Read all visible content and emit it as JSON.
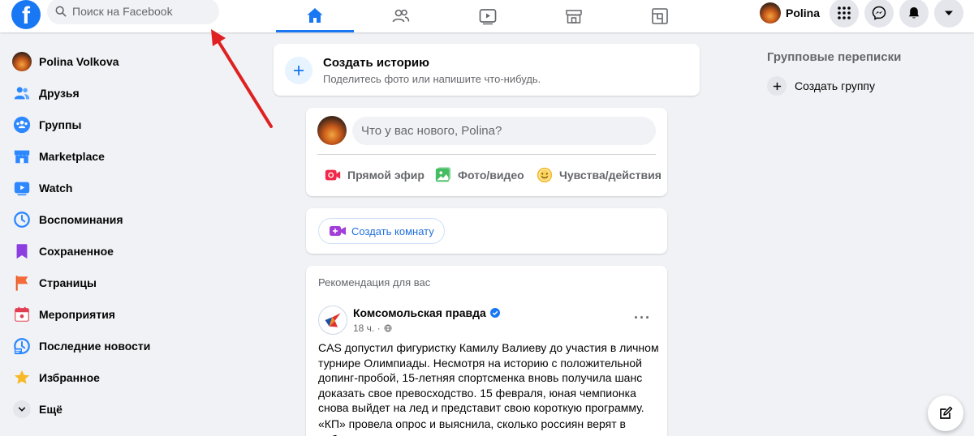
{
  "header": {
    "logo_letter": "f",
    "search_placeholder": "Поиск на Facebook",
    "profile_name": "Polina",
    "nav_tabs": [
      "home-icon",
      "friends-icon",
      "watch-icon",
      "marketplace-icon",
      "gaming-icon"
    ],
    "active_tab": "home-icon",
    "right_buttons": [
      "menu-grid-icon",
      "messenger-icon",
      "notifications-icon",
      "account-dropdown-icon"
    ]
  },
  "sidebar": {
    "items": [
      {
        "label": "Polina Volkova",
        "icon": "user-avatar"
      },
      {
        "label": "Друзья",
        "icon": "friends-icon"
      },
      {
        "label": "Группы",
        "icon": "groups-icon"
      },
      {
        "label": "Marketplace",
        "icon": "marketplace-icon"
      },
      {
        "label": "Watch",
        "icon": "watch-icon"
      },
      {
        "label": "Воспоминания",
        "icon": "memories-icon"
      },
      {
        "label": "Сохраненное",
        "icon": "saved-icon"
      },
      {
        "label": "Страницы",
        "icon": "pages-icon"
      },
      {
        "label": "Мероприятия",
        "icon": "events-icon"
      },
      {
        "label": "Последние новости",
        "icon": "recent-news-icon"
      },
      {
        "label": "Избранное",
        "icon": "favorites-icon"
      },
      {
        "label": "Ещё",
        "icon": "chevron-down-icon"
      }
    ]
  },
  "story": {
    "title": "Создать историю",
    "subtitle": "Поделитесь фото или напишите что-нибудь."
  },
  "composer": {
    "placeholder": "Что у вас нового, Polina?",
    "actions": [
      {
        "label": "Прямой эфир",
        "icon": "live-video-icon",
        "color": "#f02849"
      },
      {
        "label": "Фото/видео",
        "icon": "photo-video-icon",
        "color": "#45bd62"
      },
      {
        "label": "Чувства/действия",
        "icon": "feeling-icon",
        "color": "#f7b928"
      }
    ]
  },
  "room": {
    "label": "Создать комнату"
  },
  "post": {
    "recommendation_label": "Рекомендация для вас",
    "page_name": "Комсомольская правда",
    "time": "18 ч. ·",
    "more": "···",
    "text": "CAS допустил фигуристку Камилу Валиеву до участия в личном турнире Олимпиады. Несмотря на историю с положительной допинг-пробой, 15-летняя спортсменка вновь получила шанс доказать свое превосходство. 15 февраля, юная чемпионка снова выйдет на лед и представит свою короткую программу.",
    "text2": "«КП» провела опрос и выяснила, сколько россиян верят в победу"
  },
  "right": {
    "contacts_title": "Групповые переписки",
    "create_group": "Создать группу"
  },
  "colors": {
    "brand": "#1877f2",
    "background": "#f0f2f5",
    "annotation_arrow": "#e02020"
  }
}
